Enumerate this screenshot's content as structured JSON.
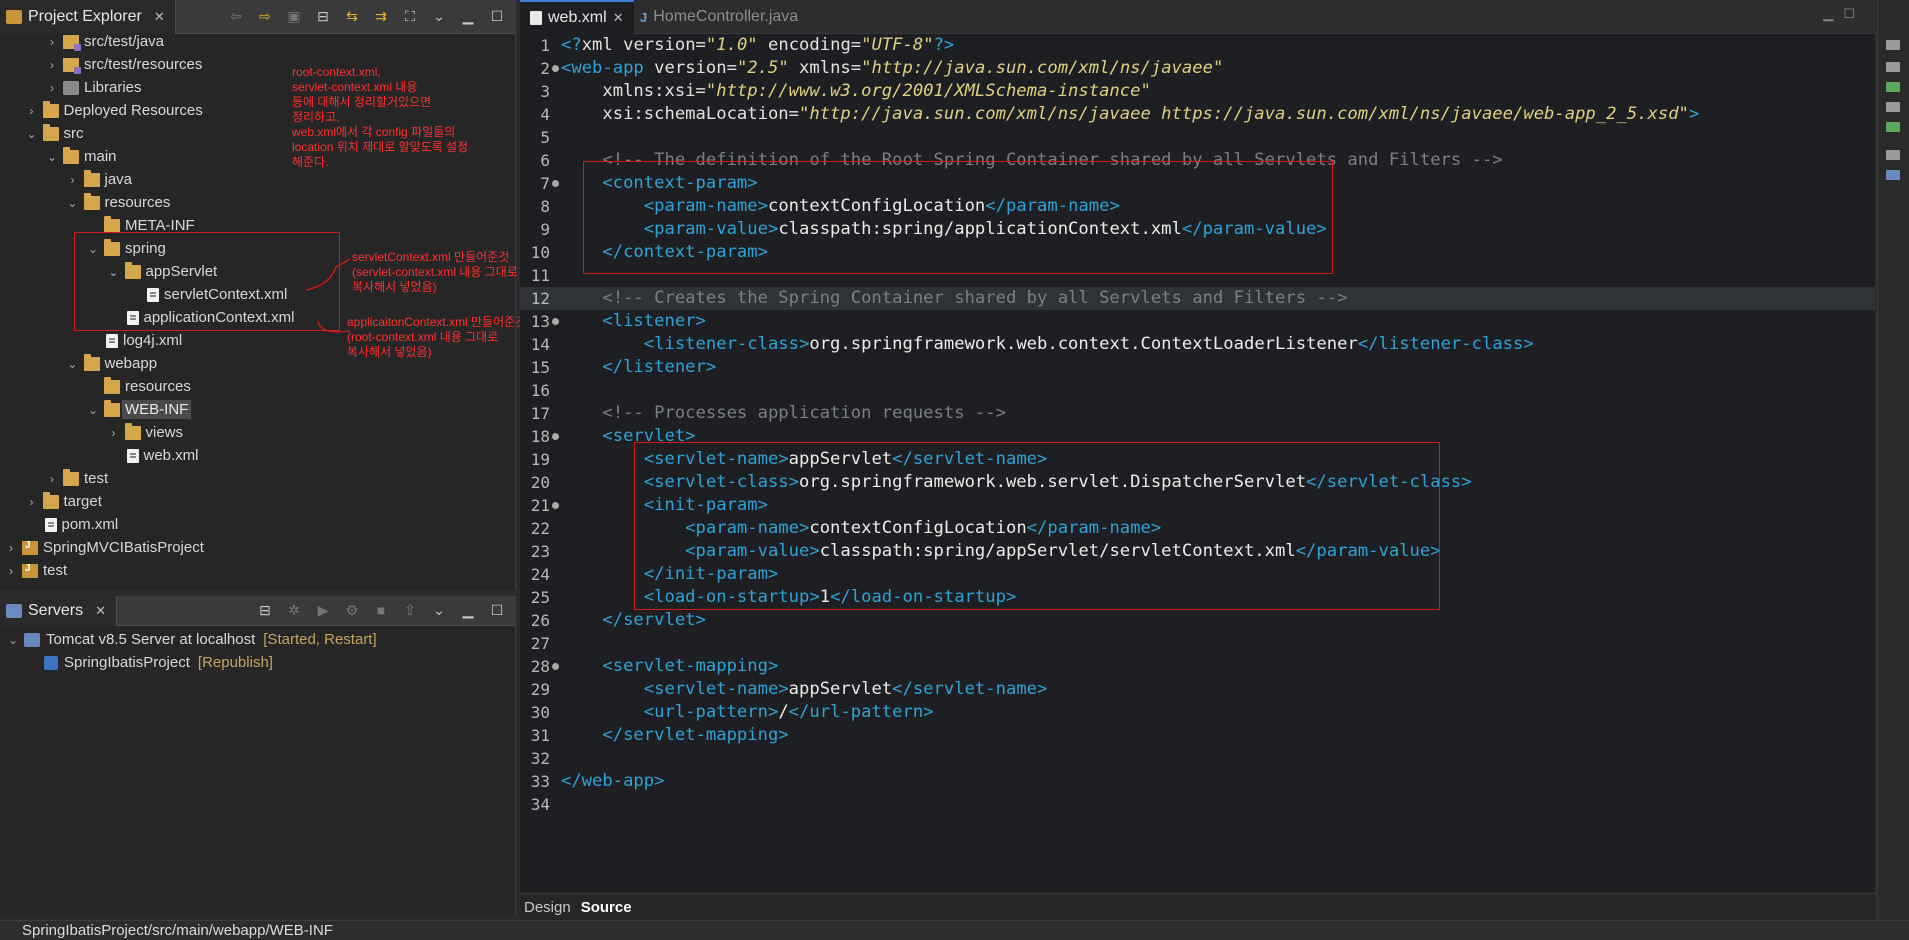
{
  "explorer": {
    "title": "Project Explorer",
    "tree": [
      {
        "label": "src/test/java",
        "indent": 3,
        "twisty": "›",
        "icon": "pkg-folder"
      },
      {
        "label": "src/test/resources",
        "indent": 3,
        "twisty": "›",
        "icon": "pkg-folder"
      },
      {
        "label": "Libraries",
        "indent": 3,
        "twisty": "›",
        "icon": "lib"
      },
      {
        "label": "Deployed Resources",
        "indent": 2,
        "twisty": "›",
        "icon": "folder"
      },
      {
        "label": "src",
        "indent": 2,
        "twisty": "⌄",
        "icon": "folder"
      },
      {
        "label": "main",
        "indent": 3,
        "twisty": "⌄",
        "icon": "folder"
      },
      {
        "label": "java",
        "indent": 4,
        "twisty": "›",
        "icon": "folder"
      },
      {
        "label": "resources",
        "indent": 4,
        "twisty": "⌄",
        "icon": "folder"
      },
      {
        "label": "META-INF",
        "indent": 5,
        "twisty": "",
        "icon": "folder"
      },
      {
        "label": "spring",
        "indent": 5,
        "twisty": "⌄",
        "icon": "folder"
      },
      {
        "label": "appServlet",
        "indent": 6,
        "twisty": "⌄",
        "icon": "folder"
      },
      {
        "label": "servletContext.xml",
        "indent": 7,
        "twisty": "",
        "icon": "file"
      },
      {
        "label": "applicationContext.xml",
        "indent": 6,
        "twisty": "",
        "icon": "file"
      },
      {
        "label": "log4j.xml",
        "indent": 5,
        "twisty": "",
        "icon": "file"
      },
      {
        "label": "webapp",
        "indent": 4,
        "twisty": "⌄",
        "icon": "folder"
      },
      {
        "label": "resources",
        "indent": 5,
        "twisty": "",
        "icon": "folder"
      },
      {
        "label": "WEB-INF",
        "indent": 5,
        "twisty": "⌄",
        "icon": "folder",
        "selected": true
      },
      {
        "label": "views",
        "indent": 6,
        "twisty": "›",
        "icon": "folder"
      },
      {
        "label": "web.xml",
        "indent": 6,
        "twisty": "",
        "icon": "file"
      },
      {
        "label": "test",
        "indent": 3,
        "twisty": "›",
        "icon": "folder"
      },
      {
        "label": "target",
        "indent": 2,
        "twisty": "›",
        "icon": "folder"
      },
      {
        "label": "pom.xml",
        "indent": 2,
        "twisty": "",
        "icon": "file"
      },
      {
        "label": "SpringMVCIBatisProject",
        "indent": 1,
        "twisty": "›",
        "icon": "project"
      },
      {
        "label": "test",
        "indent": 1,
        "twisty": "›",
        "icon": "project"
      }
    ],
    "annotations": {
      "note1": [
        "root-context.xml,",
        "servlet-context.xml 내용",
        "등에 대해서 정리할거있으면",
        "정리하고,",
        "web.xml에서 각 config 파일들의",
        "location 위치 제대로 알맞도록 설정",
        "해준다."
      ],
      "note2": [
        "servletContext.xml 만들어준것",
        "(servlet-context.xml 내용 그대로",
        "복사해서 넣었음)"
      ],
      "note3": [
        "applicaitonContext.xml 만들어준것",
        "(root-context.xml 내용 그대로",
        "복사해서 넣었음)"
      ]
    }
  },
  "servers": {
    "title": "Servers",
    "rows": [
      {
        "label": "Tomcat v8.5 Server at localhost",
        "status": "[Started, Restart]",
        "indent": 0,
        "twisty": "⌄",
        "icon": "server"
      },
      {
        "label": "SpringIbatisProject",
        "status": "[Republish]",
        "indent": 1,
        "twisty": "",
        "icon": "deploy"
      }
    ]
  },
  "editor": {
    "tabs": {
      "active": "web.xml",
      "inactive": "HomeController.java"
    },
    "bottom_tabs": {
      "design": "Design",
      "source": "Source"
    },
    "current_line": 12,
    "lines": [
      [
        [
          "tg",
          "<?"
        ],
        [
          "at",
          "xml "
        ],
        [
          "at",
          "version="
        ],
        [
          "av",
          "\"1.0\""
        ],
        [
          "at",
          " encoding="
        ],
        [
          "av",
          "\"UTF-8\""
        ],
        [
          "tg",
          "?>"
        ]
      ],
      [
        [
          "tg",
          "<web-app"
        ],
        [
          "at",
          " version="
        ],
        [
          "av",
          "\"2.5\""
        ],
        [
          "at",
          " xmlns="
        ],
        [
          "av",
          "\"http://java.sun.com/xml/ns/javaee\""
        ]
      ],
      [
        [
          "at",
          "    xmlns:xsi="
        ],
        [
          "av",
          "\"http://www.w3.org/2001/XMLSchema-instance\""
        ]
      ],
      [
        [
          "at",
          "    xsi:schemaLocation="
        ],
        [
          "av",
          "\"http://java.sun.com/xml/ns/javaee https://java.sun.com/xml/ns/javaee/web-app_2_5.xsd\""
        ],
        [
          "tg",
          ">"
        ]
      ],
      [],
      [
        [
          "cm",
          "    <!-- The definition of the Root Spring Container shared by all Servlets and Filters -->"
        ]
      ],
      [
        [
          "tg",
          "    <context-param>"
        ]
      ],
      [
        [
          "tg",
          "        <param-name>"
        ],
        [
          "tx",
          "contextConfigLocation"
        ],
        [
          "tg",
          "</param-name>"
        ]
      ],
      [
        [
          "tg",
          "        <param-value>"
        ],
        [
          "tx",
          "classpath:spring/applicationContext.xml"
        ],
        [
          "tg",
          "</param-value>"
        ]
      ],
      [
        [
          "tg",
          "    </context-param>"
        ]
      ],
      [],
      [
        [
          "cm",
          "    <!-- Creates the Spring Container shared by all Servlets and Filters -->"
        ]
      ],
      [
        [
          "tg",
          "    <listener>"
        ]
      ],
      [
        [
          "tg",
          "        <listener-class>"
        ],
        [
          "tx",
          "org.springframework.web.context.ContextLoaderListener"
        ],
        [
          "tg",
          "</listener-class>"
        ]
      ],
      [
        [
          "tg",
          "    </listener>"
        ]
      ],
      [],
      [
        [
          "cm",
          "    <!-- Processes application requests -->"
        ]
      ],
      [
        [
          "tg",
          "    <servlet>"
        ]
      ],
      [
        [
          "tg",
          "        <servlet-name>"
        ],
        [
          "tx",
          "appServlet"
        ],
        [
          "tg",
          "</servlet-name>"
        ]
      ],
      [
        [
          "tg",
          "        <servlet-class>"
        ],
        [
          "tx",
          "org.springframework.web.servlet.DispatcherServlet"
        ],
        [
          "tg",
          "</servlet-class>"
        ]
      ],
      [
        [
          "tg",
          "        <init-param>"
        ]
      ],
      [
        [
          "tg",
          "            <param-name>"
        ],
        [
          "tx",
          "contextConfigLocation"
        ],
        [
          "tg",
          "</param-name>"
        ]
      ],
      [
        [
          "tg",
          "            <param-value>"
        ],
        [
          "tx",
          "classpath:spring/appServlet/servletContext.xml"
        ],
        [
          "tg",
          "</param-value>"
        ]
      ],
      [
        [
          "tg",
          "        </init-param>"
        ]
      ],
      [
        [
          "tg",
          "        <load-on-startup>"
        ],
        [
          "tx",
          "1"
        ],
        [
          "tg",
          "</load-on-startup>"
        ]
      ],
      [
        [
          "tg",
          "    </servlet>"
        ]
      ],
      [],
      [
        [
          "tg",
          "    <servlet-mapping>"
        ]
      ],
      [
        [
          "tg",
          "        <servlet-name>"
        ],
        [
          "tx",
          "appServlet"
        ],
        [
          "tg",
          "</servlet-name>"
        ]
      ],
      [
        [
          "tg",
          "        <url-pattern>"
        ],
        [
          "tx",
          "/"
        ],
        [
          "tg",
          "</url-pattern>"
        ]
      ],
      [
        [
          "tg",
          "    </servlet-mapping>"
        ]
      ],
      [],
      [
        [
          "tg",
          "</web-app>"
        ]
      ],
      []
    ],
    "fold_lines": [
      2,
      7,
      13,
      18,
      21,
      28
    ]
  },
  "statusbar": {
    "path": "SpringIbatisProject/src/main/webapp/WEB-INF"
  },
  "colors": {
    "annotation": "#ff3030",
    "tag": "#2fa3d6",
    "attr_value": "#e0d080",
    "comment": "#7b7f85"
  }
}
